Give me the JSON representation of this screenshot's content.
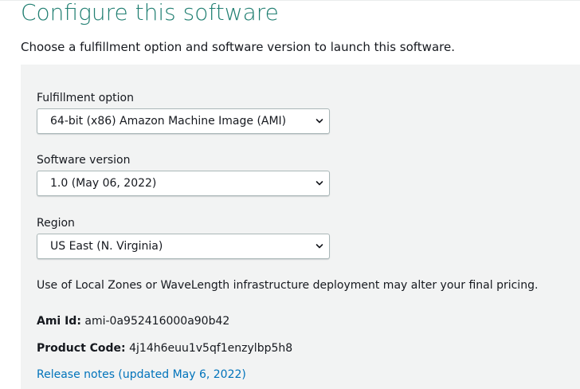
{
  "header": {
    "title": "Configure this software",
    "subtitle": "Choose a fulfillment option and software version to launch this software."
  },
  "form": {
    "fulfillment": {
      "label": "Fulfillment option",
      "value": "64-bit (x86) Amazon Machine Image (AMI)"
    },
    "version": {
      "label": "Software version",
      "value": "1.0 (May 06, 2022)"
    },
    "region": {
      "label": "Region",
      "value": "US East (N. Virginia)"
    }
  },
  "info": {
    "pricing_note": "Use of Local Zones or WaveLength infrastructure deployment may alter your final pricing.",
    "ami_id_label": "Ami Id:",
    "ami_id_value": "ami-0a952416000a90b42",
    "product_code_label": "Product Code:",
    "product_code_value": "4j14h6euu1v5qf1enzylbp5h8",
    "release_notes_link": "Release notes (updated May 6, 2022)"
  },
  "colors": {
    "title": "#217f72",
    "panel_bg": "#f2f3f3",
    "link": "#0073bb",
    "select_border": "#aab7b8"
  }
}
